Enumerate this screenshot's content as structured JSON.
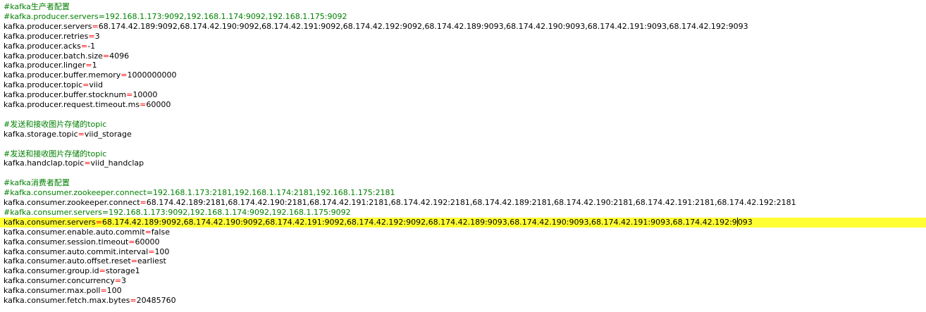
{
  "colors": {
    "comment": "#008000",
    "equals": "#ff0000",
    "text": "#000000",
    "highlight": "#ffff33"
  },
  "lines": [
    {
      "type": "comment",
      "text": "#kafka生产者配置"
    },
    {
      "type": "comment",
      "text": "#kafka.producer.servers=192.168.1.173:9092,192.168.1.174:9092,192.168.1.175:9092"
    },
    {
      "type": "kv",
      "key": "kafka.producer.servers",
      "value": "68.174.42.189:9092,68.174.42.190:9092,68.174.42.191:9092,68.174.42.192:9092,68.174.42.189:9093,68.174.42.190:9093,68.174.42.191:9093,68.174.42.192:9093"
    },
    {
      "type": "kv",
      "key": "kafka.producer.retries",
      "value": "3"
    },
    {
      "type": "kv",
      "key": "kafka.producer.acks",
      "value": "-1"
    },
    {
      "type": "kv",
      "key": "kafka.producer.batch.size",
      "value": "4096"
    },
    {
      "type": "kv",
      "key": "kafka.producer.linger",
      "value": "1"
    },
    {
      "type": "kv",
      "key": "kafka.producer.buffer.memory",
      "value": "1000000000"
    },
    {
      "type": "kv",
      "key": "kafka.producer.topic",
      "value": "viid"
    },
    {
      "type": "kv",
      "key": "kafka.producer.buffer.stocknum",
      "value": "10000"
    },
    {
      "type": "kv",
      "key": "kafka.producer.request.timeout.ms",
      "value": "60000"
    },
    {
      "type": "blank",
      "text": ""
    },
    {
      "type": "comment",
      "text": "#发送和接收图片存储的topic"
    },
    {
      "type": "kv",
      "key": "kafka.storage.topic",
      "value": "viid_storage"
    },
    {
      "type": "blank",
      "text": ""
    },
    {
      "type": "comment",
      "text": "#发送和接收图片存储的topic"
    },
    {
      "type": "kv",
      "key": "kafka.handclap.topic",
      "value": "viid_handclap"
    },
    {
      "type": "blank",
      "text": ""
    },
    {
      "type": "comment",
      "text": "#kafka消费者配置"
    },
    {
      "type": "comment",
      "text": "#kafka.consumer.zookeeper.connect=192.168.1.173:2181,192.168.1.174:2181,192.168.1.175:2181"
    },
    {
      "type": "kv",
      "key": "kafka.consumer.zookeeper.connect",
      "value": "68.174.42.189:2181,68.174.42.190:2181,68.174.42.191:2181,68.174.42.192:2181,68.174.42.189:2181,68.174.42.190:2181,68.174.42.191:2181,68.174.42.192:2181"
    },
    {
      "type": "comment",
      "text": "#kafka.consumer.servers=192.168.1.173:9092,192.168.1.174:9092,192.168.1.175:9092"
    },
    {
      "type": "kv",
      "key": "kafka.consumer.servers",
      "value": "68.174.42.189:9092,68.174.42.190:9092,68.174.42.191:9092,68.174.42.192:9092,68.174.42.189:9093,68.174.42.190:9093,68.174.42.191:9093,68.174.42.192:9",
      "value_after_caret": "093",
      "highlight": true
    },
    {
      "type": "kv",
      "key": "kafka.consumer.enable.auto.commit",
      "value": "false"
    },
    {
      "type": "kv",
      "key": "kafka.consumer.session.timeout",
      "value": "60000"
    },
    {
      "type": "kv",
      "key": "kafka.consumer.auto.commit.interval",
      "value": "100"
    },
    {
      "type": "kv",
      "key": "kafka.consumer.auto.offset.reset",
      "value": "earliest"
    },
    {
      "type": "kv",
      "key": "kafka.consumer.group.id",
      "value": "storage1"
    },
    {
      "type": "kv",
      "key": "kafka.consumer.concurrency",
      "value": "3"
    },
    {
      "type": "kv",
      "key": "kafka.consumer.max.poll",
      "value": "100"
    },
    {
      "type": "kv",
      "key": "kafka.consumer.fetch.max.bytes",
      "value": "20485760"
    }
  ]
}
